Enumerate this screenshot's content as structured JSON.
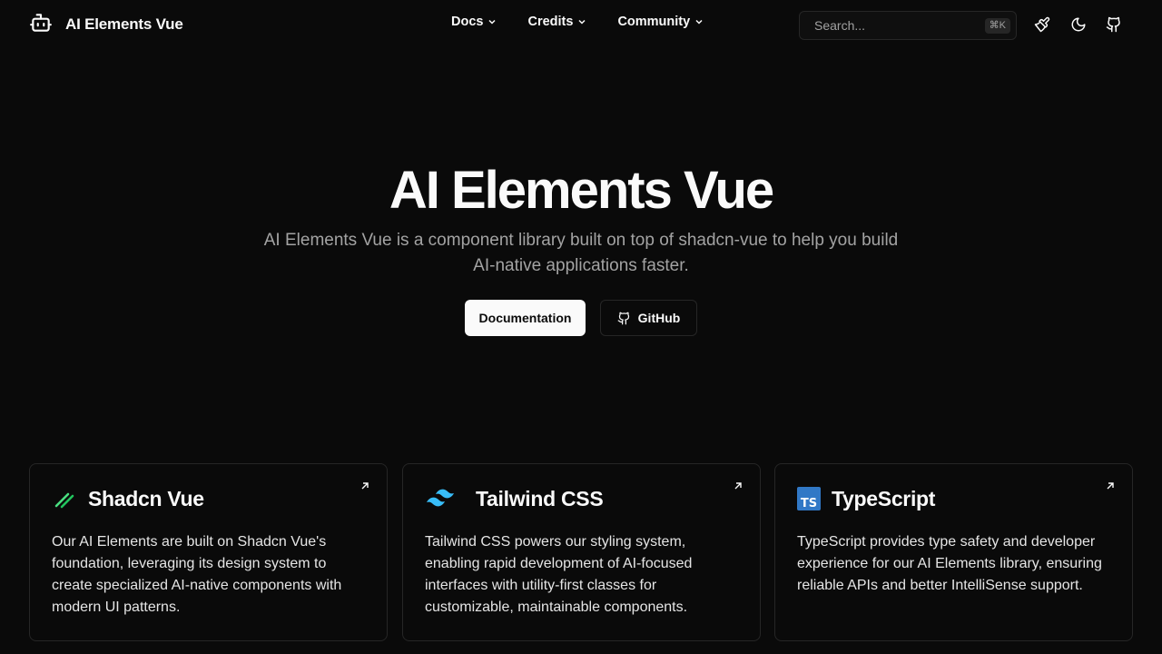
{
  "header": {
    "brand": "AI Elements Vue",
    "nav": [
      {
        "label": "Docs"
      },
      {
        "label": "Credits"
      },
      {
        "label": "Community"
      }
    ],
    "search": {
      "placeholder": "Search...",
      "shortcut": "⌘K"
    },
    "icons": [
      "paintbrush-icon",
      "moon-icon",
      "github-icon"
    ]
  },
  "hero": {
    "title": "AI Elements Vue",
    "subtitle": "AI Elements Vue is a component library built on top of shadcn-vue to help you build AI-native applications faster.",
    "primary_button": "Documentation",
    "secondary_button": "GitHub"
  },
  "cards": [
    {
      "title": "Shadcn Vue",
      "description": "Our AI Elements are built on Shadcn Vue's foundation, leveraging its design system to create specialized AI-native components with modern UI patterns.",
      "icon": "shadcn-vue-logo",
      "accent": "#4ade80"
    },
    {
      "title": "Tailwind CSS",
      "description": "Tailwind CSS powers our styling system, enabling rapid development of AI-focused interfaces with utility-first classes for customizable, maintainable components.",
      "icon": "tailwind-logo",
      "accent": "#38bdf8"
    },
    {
      "title": "TypeScript",
      "description": "TypeScript provides type safety and developer experience for our AI Elements library, ensuring reliable APIs and better IntelliSense support.",
      "icon": "typescript-logo",
      "badge_text": "TS",
      "accent": "#3178c6"
    }
  ]
}
